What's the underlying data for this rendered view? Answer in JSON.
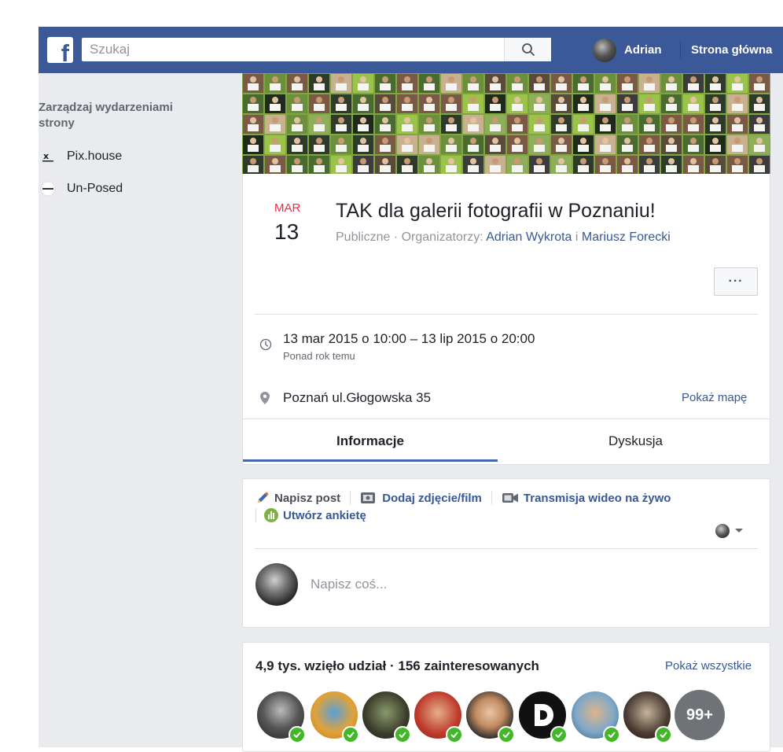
{
  "header": {
    "search_placeholder": "Szukaj",
    "user_name": "Adrian",
    "home_label": "Strona główna",
    "brand_color": "#3b5998"
  },
  "sidebar": {
    "title": "Zarządzaj wydarzeniami strony",
    "items": [
      {
        "label": "Pix.house",
        "icon": "pix-house-icon"
      },
      {
        "label": "Un-Posed",
        "icon": "un-posed-icon"
      }
    ]
  },
  "event": {
    "month": "MAR",
    "day": "13",
    "title": "TAK dla galerii fotografii w Poznaniu!",
    "meta_prefix": "Publiczne · Organizatorzy:",
    "organizer_1": "Adrian Wykrota",
    "organizer_join": "i",
    "organizer_2": "Mariusz Forecki",
    "more_label": "···",
    "time_main": "13 mar 2015 o 10:00 – 13 lip 2015 o 20:00",
    "time_sub": "Ponad rok temu",
    "place": "Poznań ul.Głogowska 35",
    "show_map": "Pokaż mapę",
    "tabs": [
      {
        "label": "Informacje",
        "active": true
      },
      {
        "label": "Dyskusja",
        "active": false
      }
    ]
  },
  "composer": {
    "write_post": "Napisz post",
    "add_photo": "Dodaj zdjęcie/film",
    "live_video": "Transmisja wideo na żywo",
    "create_poll": "Utwórz ankietę",
    "placeholder": "Napisz coś..."
  },
  "attendees": {
    "summary": "4,9 tys. wzięło udział · 156 zainteresowanych",
    "show_all": "Pokaż wszystkie",
    "more_count": "99+"
  }
}
